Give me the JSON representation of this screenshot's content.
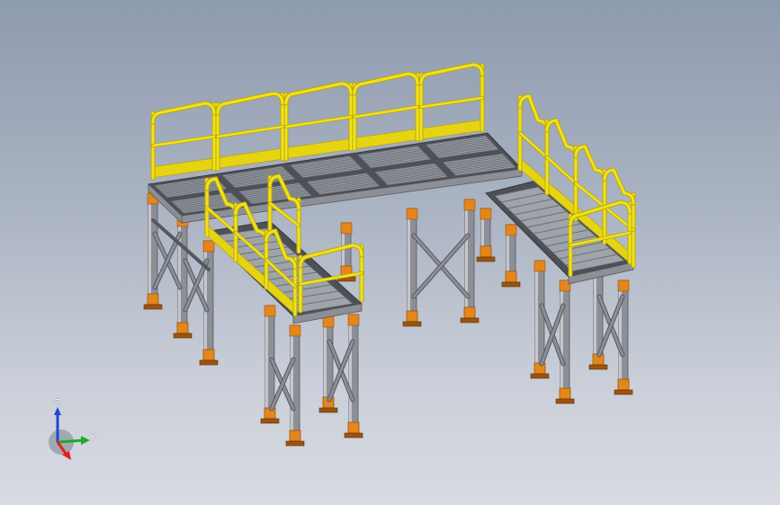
{
  "viewport": {
    "background_top": "#8e9aae",
    "background_bottom": "#d8dbe2"
  },
  "model": {
    "colors": {
      "railing": "#f2e21b",
      "railing_shadow": "#b8a80e",
      "kickplate": "#e6d414",
      "steel": "#8c8f96",
      "steel_dark": "#55585f",
      "steel_light": "#c4c6cc",
      "grating": "#9fa3aa",
      "grating_dark": "#4d5056",
      "leg_foot": "#e4861c",
      "leg_foot_dark": "#9c5410"
    }
  },
  "triad": {
    "z_label": "Z",
    "y_label": "Y",
    "z_color": "#2146d6",
    "y_color": "#1faa2a",
    "x_color": "#e02020",
    "icon": "coordinate-triad-icon"
  }
}
